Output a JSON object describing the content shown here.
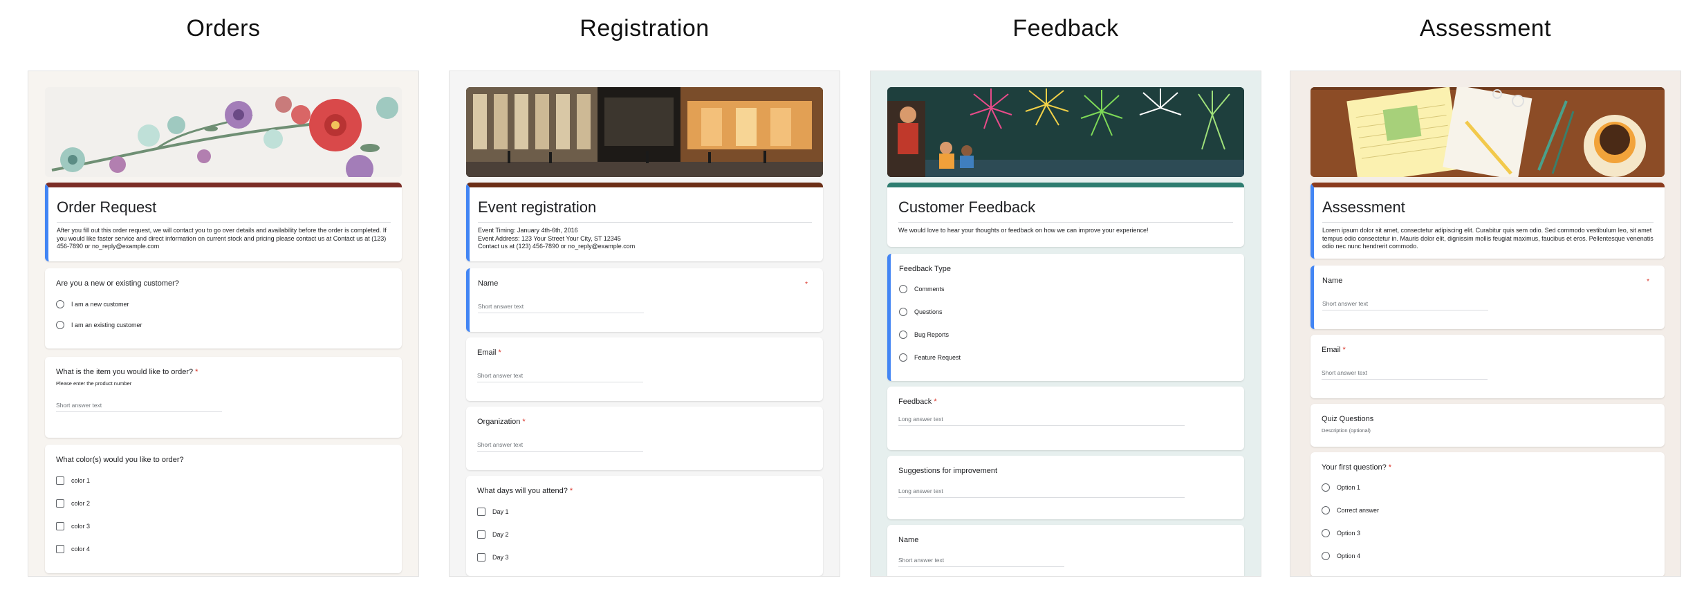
{
  "columns": {
    "orders": {
      "heading": "Orders",
      "theme_color": "#7b2d26",
      "banner": "flowers-banner",
      "form_title": "Order Request",
      "form_description": "After you fill out this order request, we will contact you to go over details and availability before the order is completed. If you would like faster service and direct information on current stock and pricing please contact us at Contact us at (123) 456-7890 or no_reply@example.com",
      "q1": {
        "label": "Are you a new or existing customer?",
        "options": [
          "I am a new customer",
          "I am an existing customer"
        ]
      },
      "q2": {
        "label": "What is the item you would like to order?",
        "helper": "Please enter the product number",
        "placeholder": "Short answer text"
      },
      "q3": {
        "label": "What color(s) would you like to order?",
        "options": [
          "color 1",
          "color 2",
          "color 3",
          "color 4"
        ]
      }
    },
    "registration": {
      "heading": "Registration",
      "theme_color": "#6b2e16",
      "banner": "building-night-banner",
      "form_title": "Event registration",
      "form_description": "Event Timing: January 4th-6th, 2016\nEvent Address: 123 Your Street Your City, ST 12345\nContact us at (123) 456-7890 or no_reply@example.com",
      "q1": {
        "label": "Name",
        "placeholder": "Short answer text"
      },
      "q2": {
        "label": "Email",
        "placeholder": "Short answer text"
      },
      "q3": {
        "label": "Organization",
        "placeholder": "Short answer text"
      },
      "q4": {
        "label": "What days will you attend?",
        "options": [
          "Day 1",
          "Day 2",
          "Day 3"
        ]
      }
    },
    "feedback": {
      "heading": "Feedback",
      "theme_color": "#2e7d70",
      "banner": "fireworks-banner",
      "form_title": "Customer Feedback",
      "form_description": "We would love to hear your thoughts or feedback on how we can improve your experience!",
      "q1": {
        "label": "Feedback Type",
        "options": [
          "Comments",
          "Questions",
          "Bug Reports",
          "Feature Request"
        ]
      },
      "q2": {
        "label": "Feedback",
        "placeholder": "Long answer text"
      },
      "q3": {
        "label": "Suggestions for improvement",
        "placeholder": "Long answer text"
      },
      "q4": {
        "label": "Name",
        "placeholder": "Short answer text"
      }
    },
    "assessment": {
      "heading": "Assessment",
      "theme_color": "#8a3a1d",
      "banner": "desk-coffee-banner",
      "form_title": "Assessment",
      "form_description": "Lorem ipsum dolor sit amet, consectetur adipiscing elit. Curabitur quis sem odio. Sed commodo vestibulum leo, sit amet tempus odio consectetur in. Mauris dolor elit, dignissim mollis feugiat maximus, faucibus et eros. Pellentesque venenatis odio nec nunc hendrerit commodo.",
      "q1": {
        "label": "Name",
        "placeholder": "Short answer text"
      },
      "q2": {
        "label": "Email",
        "placeholder": "Short answer text"
      },
      "q3": {
        "label": "Quiz Questions",
        "description": "Description (optional)"
      },
      "q4": {
        "label": "Your first question?",
        "options": [
          "Option 1",
          "Correct answer",
          "Option 3",
          "Option 4"
        ]
      }
    }
  },
  "required_mark": "*"
}
